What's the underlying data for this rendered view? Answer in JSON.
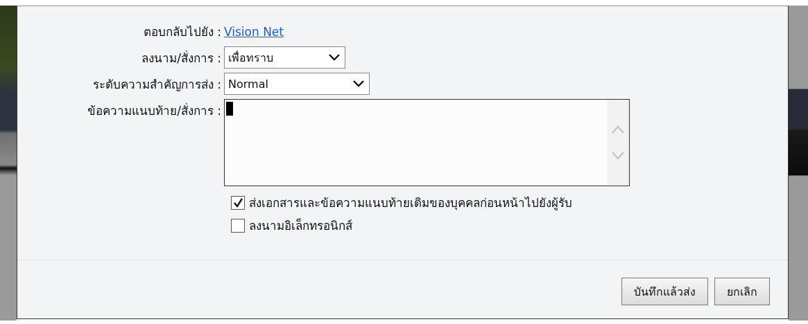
{
  "dialog": {
    "fields": [
      {
        "kind": "link",
        "label": "ตอบกลับไปยัง :",
        "value": "Vision Net"
      },
      {
        "kind": "select",
        "label": "ลงนาม/สั่งการ :",
        "value": "เพื่อทราบ"
      },
      {
        "kind": "select",
        "label": "ระดับความสำคัญการส่ง :",
        "value": "Normal"
      },
      {
        "kind": "textarea",
        "label": "ข้อความแนบท้าย/สั่งการ :"
      }
    ],
    "options": [
      {
        "label": "ส่งเอกสารและข้อความแนบท้ายเดิมของบุคคลก่อนหน้าไปยังผู้รับ",
        "checked": true
      },
      {
        "label": "ลงนามอิเล็กทรอนิกส์",
        "checked": false
      }
    ],
    "buttons": [
      "บันทึกแล้วส่ง",
      "ยกเลิก"
    ]
  }
}
